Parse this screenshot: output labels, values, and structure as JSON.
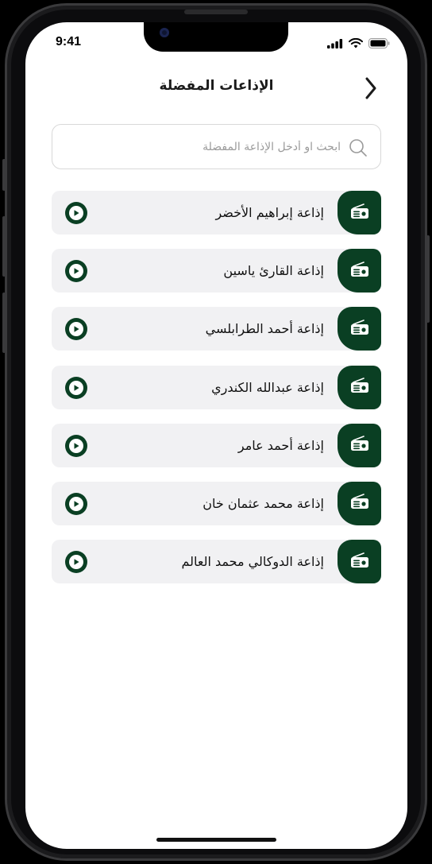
{
  "status_bar": {
    "time": "9:41"
  },
  "header": {
    "title": "الإذاعات المفضلة"
  },
  "search": {
    "placeholder": "ابحث او أدخل الإذاعة المفضلة",
    "value": ""
  },
  "stations": [
    {
      "name": "إذاعة إبراهيم الأخضر"
    },
    {
      "name": "إذاعة القارئ ياسين"
    },
    {
      "name": "إذاعة أحمد الطرابلسي"
    },
    {
      "name": "إذاعة عبدالله الكندري"
    },
    {
      "name": "إذاعة أحمد عامر"
    },
    {
      "name": "إذاعة محمد عثمان خان"
    },
    {
      "name": "إذاعة الدوكالي محمد العالم"
    }
  ],
  "icons": {
    "back": "chevron-right-icon",
    "search": "search-icon",
    "station": "radio-icon",
    "play": "play-icon"
  },
  "colors": {
    "accent": "#0a3f23",
    "item_bg": "#f1f1f3"
  }
}
